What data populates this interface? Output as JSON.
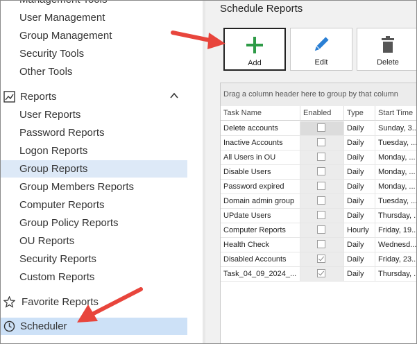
{
  "sidebar": {
    "management_items": [
      {
        "name": "sidebar-item-management-tools",
        "label": "Management Tools"
      },
      {
        "name": "sidebar-item-user-management",
        "label": "User Management"
      },
      {
        "name": "sidebar-item-group-management",
        "label": "Group Management"
      },
      {
        "name": "sidebar-item-security-tools",
        "label": "Security Tools"
      },
      {
        "name": "sidebar-item-other-tools",
        "label": "Other Tools"
      }
    ],
    "reports_header": {
      "label": "Reports",
      "icon": "chart-icon",
      "chevron": "chevron-up-icon"
    },
    "report_items": [
      {
        "name": "sidebar-item-user-reports",
        "label": "User Reports"
      },
      {
        "name": "sidebar-item-password-reports",
        "label": "Password Reports"
      },
      {
        "name": "sidebar-item-logon-reports",
        "label": "Logon Reports"
      },
      {
        "name": "sidebar-item-group-reports",
        "label": "Group Reports",
        "selected": true
      },
      {
        "name": "sidebar-item-group-members-reports",
        "label": "Group Members Reports"
      },
      {
        "name": "sidebar-item-computer-reports",
        "label": "Computer Reports"
      },
      {
        "name": "sidebar-item-group-policy-reports",
        "label": "Group Policy Reports"
      },
      {
        "name": "sidebar-item-ou-reports",
        "label": "OU Reports"
      },
      {
        "name": "sidebar-item-security-reports",
        "label": "Security Reports"
      },
      {
        "name": "sidebar-item-custom-reports",
        "label": "Custom Reports"
      }
    ],
    "favorite": {
      "label": "Favorite Reports",
      "icon": "star-icon"
    },
    "scheduler": {
      "label": "Scheduler",
      "icon": "clock-icon"
    }
  },
  "main": {
    "title": "Schedule Reports",
    "toolbar": {
      "add_label": "Add",
      "edit_label": "Edit",
      "delete_label": "Delete"
    },
    "grid": {
      "group_hint": "Drag a column header here to group by that column",
      "columns": [
        "Task Name",
        "Enabled",
        "Type",
        "Start Time"
      ],
      "rows": [
        {
          "task": "Delete accounts",
          "enabled": false,
          "type": "Daily",
          "start": "Sunday, 3..."
        },
        {
          "task": "Inactive Accounts",
          "enabled": false,
          "type": "Daily",
          "start": "Tuesday, ..."
        },
        {
          "task": "All Users in OU",
          "enabled": false,
          "type": "Daily",
          "start": "Monday, ..."
        },
        {
          "task": "Disable Users",
          "enabled": false,
          "type": "Daily",
          "start": "Monday, ..."
        },
        {
          "task": "Password expired",
          "enabled": false,
          "type": "Daily",
          "start": "Monday, ..."
        },
        {
          "task": "Domain admin group",
          "enabled": false,
          "type": "Daily",
          "start": "Tuesday, ..."
        },
        {
          "task": "UPdate Users",
          "enabled": false,
          "type": "Daily",
          "start": "Thursday, ..."
        },
        {
          "task": "Computer Reports",
          "enabled": false,
          "type": "Hourly",
          "start": "Friday, 19..."
        },
        {
          "task": "Health Check",
          "enabled": false,
          "type": "Daily",
          "start": "Wednesd..."
        },
        {
          "task": "Disabled Accounts",
          "enabled": true,
          "type": "Daily",
          "start": "Friday, 23..."
        },
        {
          "task": "Task_04_09_2024_...",
          "enabled": true,
          "type": "Daily",
          "start": "Thursday, ..."
        }
      ]
    }
  },
  "colors": {
    "accent_arrow": "#e8453c",
    "add_icon": "#2e9b47",
    "edit_icon": "#2a7fd4",
    "delete_icon": "#555555",
    "selection": "#dde9f7"
  }
}
